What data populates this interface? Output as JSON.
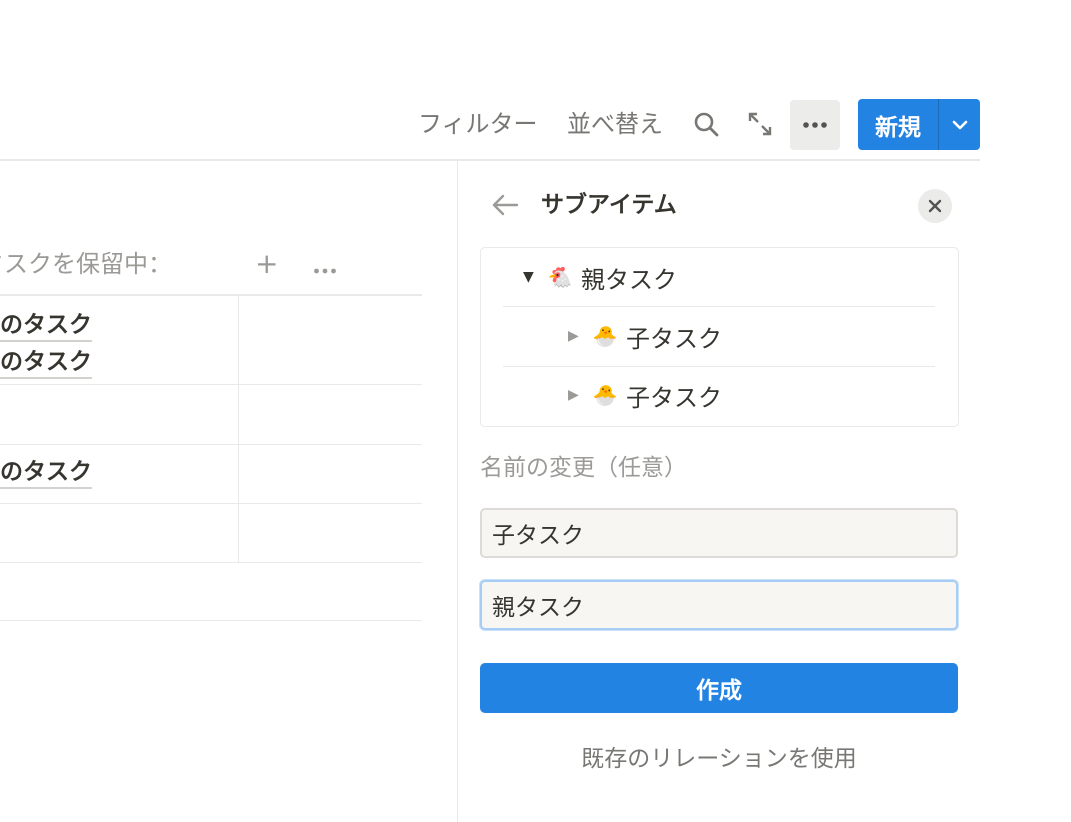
{
  "toolbar": {
    "filter_label": "フィルター",
    "sort_label": "並べ替え",
    "new_label": "新規",
    "icons": [
      "search-icon",
      "expand-icon",
      "more-icon",
      "chevron-down-icon"
    ]
  },
  "board": {
    "group_label": "タスクを保留中：",
    "rows": [
      {
        "lines": [
          "のタスク",
          "のタスク"
        ]
      },
      {
        "lines": []
      },
      {
        "lines": [
          "のタスク"
        ]
      },
      {
        "lines": []
      }
    ]
  },
  "panel": {
    "title": "サブアイテム",
    "tree": [
      {
        "label": "親タスク",
        "icon": "🐔",
        "expanded": true
      },
      {
        "label": "子タスク",
        "icon": "🐣",
        "expanded": false
      },
      {
        "label": "子タスク",
        "icon": "🐣",
        "expanded": false
      }
    ],
    "rename_label": "名前の変更（任意）",
    "child_field_value": "子タスク",
    "parent_field_value": "親タスク",
    "create_label": "作成",
    "existing_relation_label": "既存のリレーションを使用"
  },
  "colors": {
    "accent": "#2383e2",
    "text": "#37352f",
    "muted": "#787774"
  }
}
